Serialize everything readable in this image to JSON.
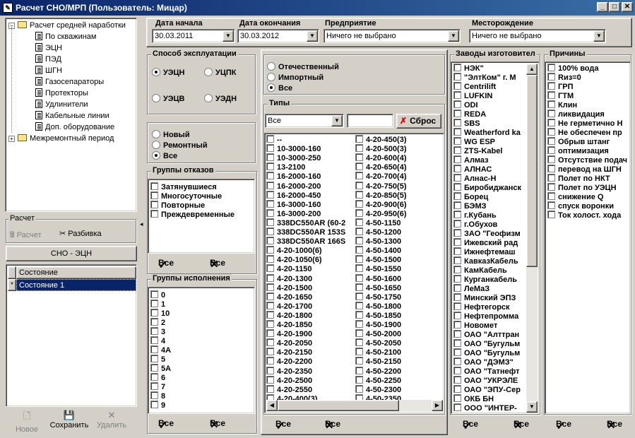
{
  "window": {
    "title": "Расчет СНО/МРП    (Пользователь: Мицар)"
  },
  "tree": {
    "root": "Расчет средней наработки",
    "children": [
      "По скважинам",
      "ЭЦН",
      "ПЭД",
      "ШГН",
      "Газосепараторы",
      "Протекторы",
      "Удлинители",
      "Кабельные линии",
      "Доп. оборудование"
    ],
    "sibling": "Межремонтный период"
  },
  "calc": {
    "title": "Расчет",
    "calc_label": "Расчет",
    "split_label": "Разбивка"
  },
  "sno_header": "СНО - ЭЦН",
  "state_grid": {
    "header": "Состояние",
    "row": "Состояние 1",
    "marker": "*"
  },
  "bottom_buttons": {
    "new": "Новое",
    "save": "Сохранить",
    "delete": "Удалить"
  },
  "filters": {
    "date_start_label": "Дата начала",
    "date_start": "30.03.2011",
    "date_end_label": "Дата окончания",
    "date_end": "30.03.2012",
    "company_label": "Предприятие",
    "company": "Ничего не выбрано",
    "field_label": "Месторождение",
    "field": "Ничего не выбрано"
  },
  "exploitation": {
    "title": "Способ эксплуатации",
    "options": [
      "УЭЦН",
      "УЦПК",
      "УЭЦВ",
      "УЭДН"
    ],
    "selected": 0
  },
  "condition": {
    "options": [
      "Новый",
      "Ремонтный",
      "Все"
    ],
    "selected": 2
  },
  "origin": {
    "options": [
      "Отечественный",
      "Импортный",
      "Все"
    ],
    "selected": 2
  },
  "fail_groups": {
    "title": "Группы отказов",
    "items": [
      "Затянувшиеся",
      "Многосуточные",
      "Повторные",
      "Преждевременные"
    ]
  },
  "exec_groups": {
    "title": "Группы исполнения",
    "items": [
      "0",
      "1",
      "10",
      "2",
      "3",
      "4",
      "4А",
      "5",
      "5А",
      "6",
      "7",
      "8",
      "9"
    ]
  },
  "types": {
    "title": "Типы",
    "filter_value": "Все",
    "reset_label": "Сброс",
    "col1": [
      "--",
      "10-3000-160",
      "10-3000-250",
      "13-2100",
      "16-2000-160",
      "16-2000-200",
      "16-2000-450",
      "16-3000-160",
      "16-3000-200",
      "338DC550AR (60-2",
      "338DC550AR 153S",
      "338DC550AR 166S",
      "4-20-1000(6)",
      "4-20-1050(6)",
      "4-20-1150",
      "4-20-1300",
      "4-20-1500",
      "4-20-1650",
      "4-20-1700",
      "4-20-1800",
      "4-20-1850",
      "4-20-1900",
      "4-20-2050",
      "4-20-2150",
      "4-20-2200",
      "4-20-2350",
      "4-20-2500",
      "4-20-2550",
      "4-20-400(3)"
    ],
    "col2": [
      "4-20-450(3)",
      "4-20-500(3)",
      "4-20-600(4)",
      "4-20-650(4)",
      "4-20-700(4)",
      "4-20-750(5)",
      "4-20-850(5)",
      "4-20-900(6)",
      "4-20-950(6)",
      "4-50-1150",
      "4-50-1200",
      "4-50-1300",
      "4-50-1400",
      "4-50-1500",
      "4-50-1550",
      "4-50-1600",
      "4-50-1650",
      "4-50-1750",
      "4-50-1800",
      "4-50-1850",
      "4-50-1900",
      "4-50-2000",
      "4-50-2050",
      "4-50-2100",
      "4-50-2150",
      "4-50-2200",
      "4-50-2250",
      "4-50-2300",
      "4-50-2350"
    ]
  },
  "factories": {
    "title": "Заводы изготовител",
    "items": [
      "НЭК\"",
      "\"ЭлтКом\" г. М",
      "Centrilift",
      "LUFKIN",
      "ODI",
      "REDA",
      "SBS",
      "Weatherford ka",
      "WG ESP",
      "ZTS-Kabel",
      "Алмаз",
      "АЛНАС",
      "Алнас-Н",
      "Биробиджанск",
      "Борец",
      "БЭМЗ",
      "г.Кубань",
      "г.Обухов",
      "ЗАО \"Геофизм",
      "Ижевский рад",
      "Ижнефтемаш",
      "КавказКабель",
      "КамКабель",
      "Курганкабель",
      "ЛеМаЗ",
      "Минский ЭПЗ",
      "Нефтегорск",
      "Нефтепромма",
      "Новомет",
      "ОАО \"Алттран",
      "ОАО \"Бугульм",
      "ОАО \"Бугульм",
      "ОАО \"ДЭМЗ\"",
      "ОАО \"Татнефт",
      "ОАО \"УКРЭЛЕ",
      "ОАО \"ЭПУ-Сер",
      "ОКБ БН",
      "ООО \"ИНТЕР-"
    ]
  },
  "reasons": {
    "title": "Причины",
    "items": [
      "100% вода",
      "Rиз=0",
      "ГРП",
      "ГТМ",
      "Клин",
      "ликвидация",
      "Не герметично Н",
      "Не обеспечен пр",
      "Обрыв штанг",
      "оптимизация",
      "Отсутствие подач",
      "перевод на ШГН",
      "Полет по НКТ",
      "Полет по УЭЦН",
      "снижение Q",
      "спуск воронки",
      "Ток холост. хода"
    ]
  },
  "all_label": "Все"
}
